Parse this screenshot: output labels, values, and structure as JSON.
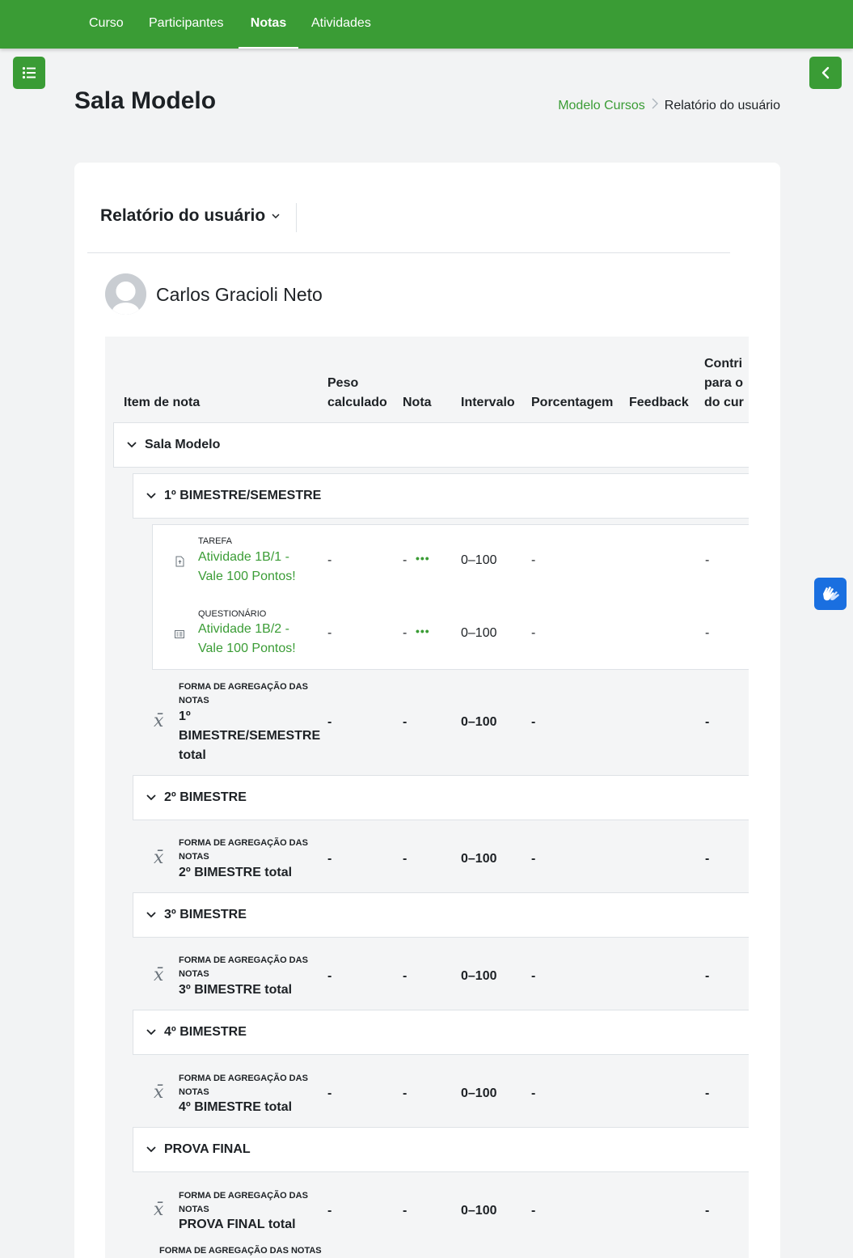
{
  "nav": {
    "items": [
      {
        "label": "Curso",
        "active": false
      },
      {
        "label": "Participantes",
        "active": false
      },
      {
        "label": "Notas",
        "active": true
      },
      {
        "label": "Atividades",
        "active": false
      }
    ]
  },
  "icons": {
    "drawer_left": "list-icon",
    "drawer_right": "chevron-left-icon",
    "accessibility": "sign-language-hands-icon"
  },
  "colors": {
    "brand": "#3a9c35",
    "accessibility": "#1a6fe0"
  },
  "page": {
    "title": "Sala Modelo"
  },
  "breadcrumb": {
    "link": "Modelo Cursos",
    "current": "Relatório do usuário"
  },
  "report": {
    "selector_label": "Relatório do usuário",
    "user_name": "Carlos Gracioli Neto"
  },
  "table": {
    "headers": {
      "item": "Item de nota",
      "peso_1": "Peso",
      "peso_2": "calculado",
      "nota": "Nota",
      "intervalo": "Intervalo",
      "porcentagem": "Porcentagem",
      "feedback": "Feedback",
      "contrib_1": "Contri",
      "contrib_2": "para o",
      "contrib_3": "do cur"
    },
    "course": "Sala Modelo",
    "cat1": {
      "name": "1º BIMESTRE/SEMESTRE",
      "items": [
        {
          "type": "TAREFA",
          "name_1": "Atividade 1B/1 -",
          "name_2": "Vale 100 Pontos!",
          "peso": "-",
          "nota": "-",
          "intervalo": "0–100",
          "porcentagem": "-",
          "contrib": "-"
        },
        {
          "type": "QUESTIONÁRIO",
          "name_1": "Atividade 1B/2 -",
          "name_2": "Vale 100 Pontos!",
          "peso": "-",
          "nota": "-",
          "intervalo": "0–100",
          "porcentagem": "-",
          "contrib": "-"
        }
      ],
      "total": {
        "type": "FORMA DE AGREGAÇÃO DAS NOTAS",
        "name_1": "1º",
        "name_2": "BIMESTRE/SEMESTRE",
        "name_3": "total",
        "peso": "-",
        "nota": "-",
        "intervalo": "0–100",
        "porcentagem": "-",
        "contrib": "-"
      }
    },
    "cat2": {
      "name": "2º BIMESTRE",
      "total": {
        "type": "FORMA DE AGREGAÇÃO DAS NOTAS",
        "name": "2º BIMESTRE total",
        "peso": "-",
        "nota": "-",
        "intervalo": "0–100",
        "porcentagem": "-",
        "contrib": "-"
      }
    },
    "cat3": {
      "name": "3º BIMESTRE",
      "total": {
        "type": "FORMA DE AGREGAÇÃO DAS NOTAS",
        "name": "3º BIMESTRE total",
        "peso": "-",
        "nota": "-",
        "intervalo": "0–100",
        "porcentagem": "-",
        "contrib": "-"
      }
    },
    "cat4": {
      "name": "4º BIMESTRE",
      "total": {
        "type": "FORMA DE AGREGAÇÃO DAS NOTAS",
        "name": "4º BIMESTRE total",
        "peso": "-",
        "nota": "-",
        "intervalo": "0–100",
        "porcentagem": "-",
        "contrib": "-"
      }
    },
    "cat5": {
      "name": "PROVA FINAL",
      "total": {
        "type": "FORMA DE AGREGAÇÃO DAS NOTAS",
        "name": "PROVA FINAL total",
        "peso": "-",
        "nota": "-",
        "intervalo": "0–100",
        "porcentagem": "-",
        "contrib": "-"
      }
    },
    "course_total": {
      "type": "FORMA DE AGREGAÇÃO DAS NOTAS"
    }
  }
}
